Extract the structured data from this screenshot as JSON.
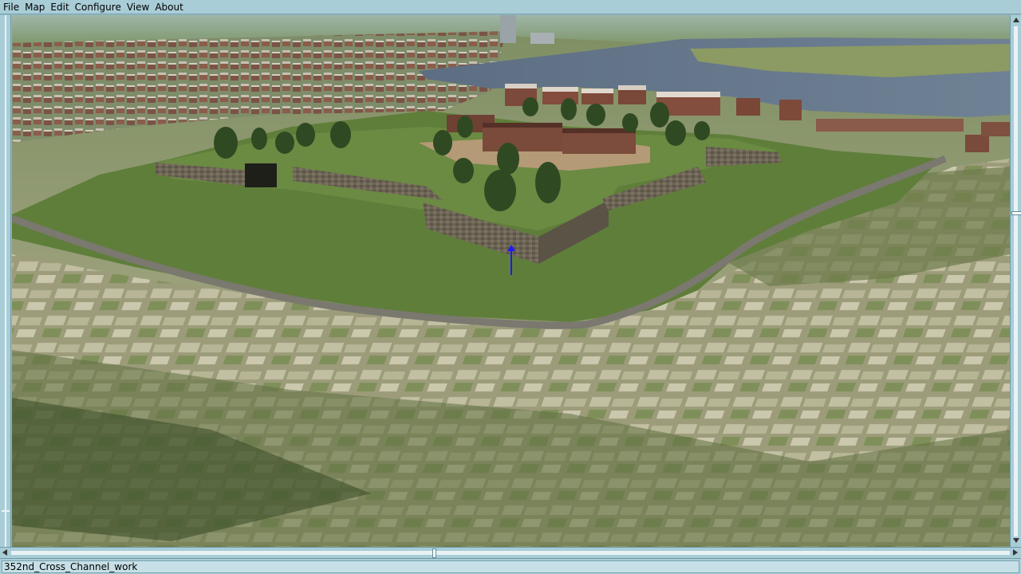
{
  "menu": {
    "file": "File",
    "map": "Map",
    "edit": "Edit",
    "configure": "Configure",
    "view": "View",
    "about": "About"
  },
  "status": {
    "scenery_name": "352nd_Cross_Channel_work"
  },
  "colors": {
    "chrome": "#a9cdd7",
    "water": "#6b7f92",
    "grass": "#5f7c3c",
    "wall": "#6d6556",
    "road": "#7c7a72",
    "marker": "#1a1aff"
  }
}
